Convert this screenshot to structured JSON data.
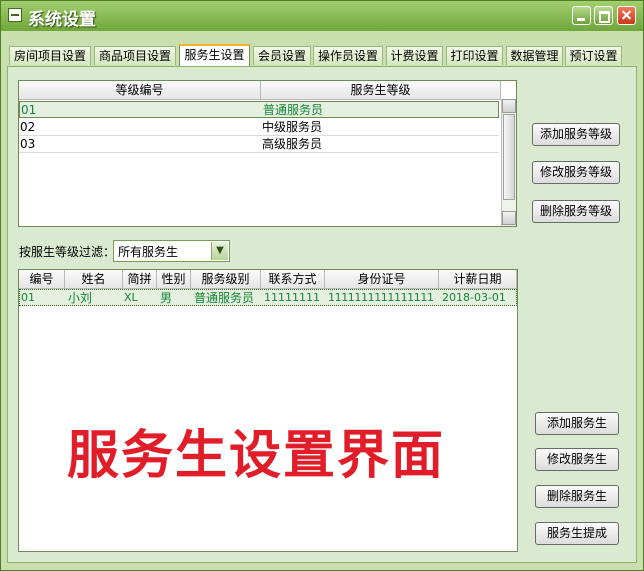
{
  "window": {
    "title": "系统设置"
  },
  "tabs": [
    "房间项目设置",
    "商品项目设置",
    "服务生设置",
    "会员设置",
    "操作员设置",
    "计费设置",
    "打印设置",
    "数据管理",
    "预订设置"
  ],
  "level_grid": {
    "headers": [
      "等级编号",
      "服务生等级"
    ],
    "rows": [
      {
        "code": "01",
        "name": "普通服务员"
      },
      {
        "code": "02",
        "name": "中级服务员"
      },
      {
        "code": "03",
        "name": "高级服务员"
      }
    ]
  },
  "level_buttons": {
    "add": "添加服务等级",
    "edit": "修改服务等级",
    "delete": "删除服务等级"
  },
  "filter": {
    "label": "按服生等级过滤：",
    "value": "所有服务生"
  },
  "waiter_grid": {
    "headers": [
      "编号",
      "姓名",
      "简拼",
      "性别",
      "服务级别",
      "联系方式",
      "身份证号",
      "计薪日期"
    ],
    "rows": [
      {
        "id": "01",
        "name": "小刘",
        "pinyin": "XL",
        "gender": "男",
        "level": "普通服务员",
        "phone": "11111111",
        "idcard": "1111111111111111",
        "date": "2018-03-01"
      }
    ]
  },
  "waiter_buttons": {
    "add": "添加服务生",
    "edit": "修改服务生",
    "delete": "删除服务生",
    "commission": "服务生提成"
  },
  "watermark": "服务生设置界面",
  "colors": {
    "title_bar": "#6fa63a",
    "panel_bg": "#d9ead0",
    "selected_text": "#15843a",
    "watermark": "#e21d2a"
  }
}
